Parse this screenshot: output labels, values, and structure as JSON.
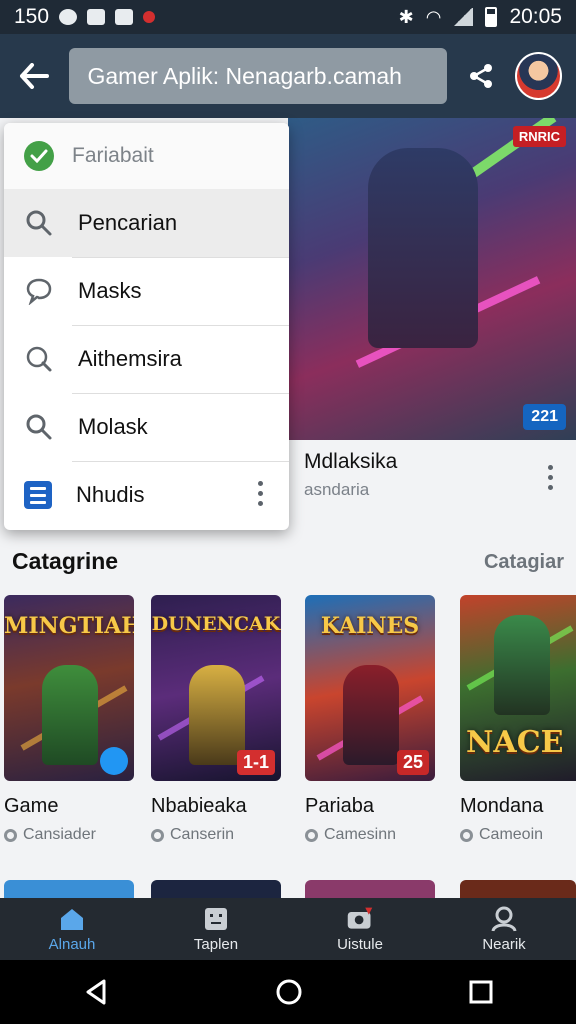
{
  "status_bar": {
    "left_text": "150",
    "time": "20:05"
  },
  "app_bar": {
    "url_text": "Gamer Aplik: Nenagarb.camah"
  },
  "dropdown": {
    "header_label": "Fariabait",
    "items": [
      {
        "label": "Pencarian",
        "icon": "search-icon"
      },
      {
        "label": "Masks",
        "icon": "chat-bubble-icon"
      },
      {
        "label": "Aithemsira",
        "icon": "search-icon"
      },
      {
        "label": "Molask",
        "icon": "search-icon"
      },
      {
        "label": "Nhudis",
        "icon": "document-icon"
      }
    ]
  },
  "hero": {
    "badge_top": "RNRIC",
    "badge_bottom": "221",
    "title": "Mdlaksika",
    "subtitle": "asndaria"
  },
  "section": {
    "title": "Catagrine",
    "more_label": "Catagiar"
  },
  "cards": [
    {
      "logo": "MINGTIAH",
      "title": "Game",
      "sub": "Cansiader",
      "badge": ""
    },
    {
      "logo": "DUNENCAK",
      "title": "Nbabieaka",
      "sub": "Canserin",
      "badge": "1-1"
    },
    {
      "logo": "KAINES",
      "title": "Pariaba",
      "sub": "Camesinn",
      "badge": "25"
    },
    {
      "logo": "NACE",
      "title": "Mondana",
      "sub": "Cameoin",
      "badge": ""
    }
  ],
  "bottom_nav": [
    {
      "label": "Alnauh",
      "icon": "home-icon",
      "active": true
    },
    {
      "label": "Taplen",
      "icon": "robot-icon",
      "active": false
    },
    {
      "label": "Uistule",
      "icon": "camera-icon",
      "active": false
    },
    {
      "label": "Nearik",
      "icon": "person-icon",
      "active": false
    }
  ],
  "colors": {
    "accent": "#5aa7ea",
    "app_bar": "#27394c",
    "check": "#43a047"
  }
}
